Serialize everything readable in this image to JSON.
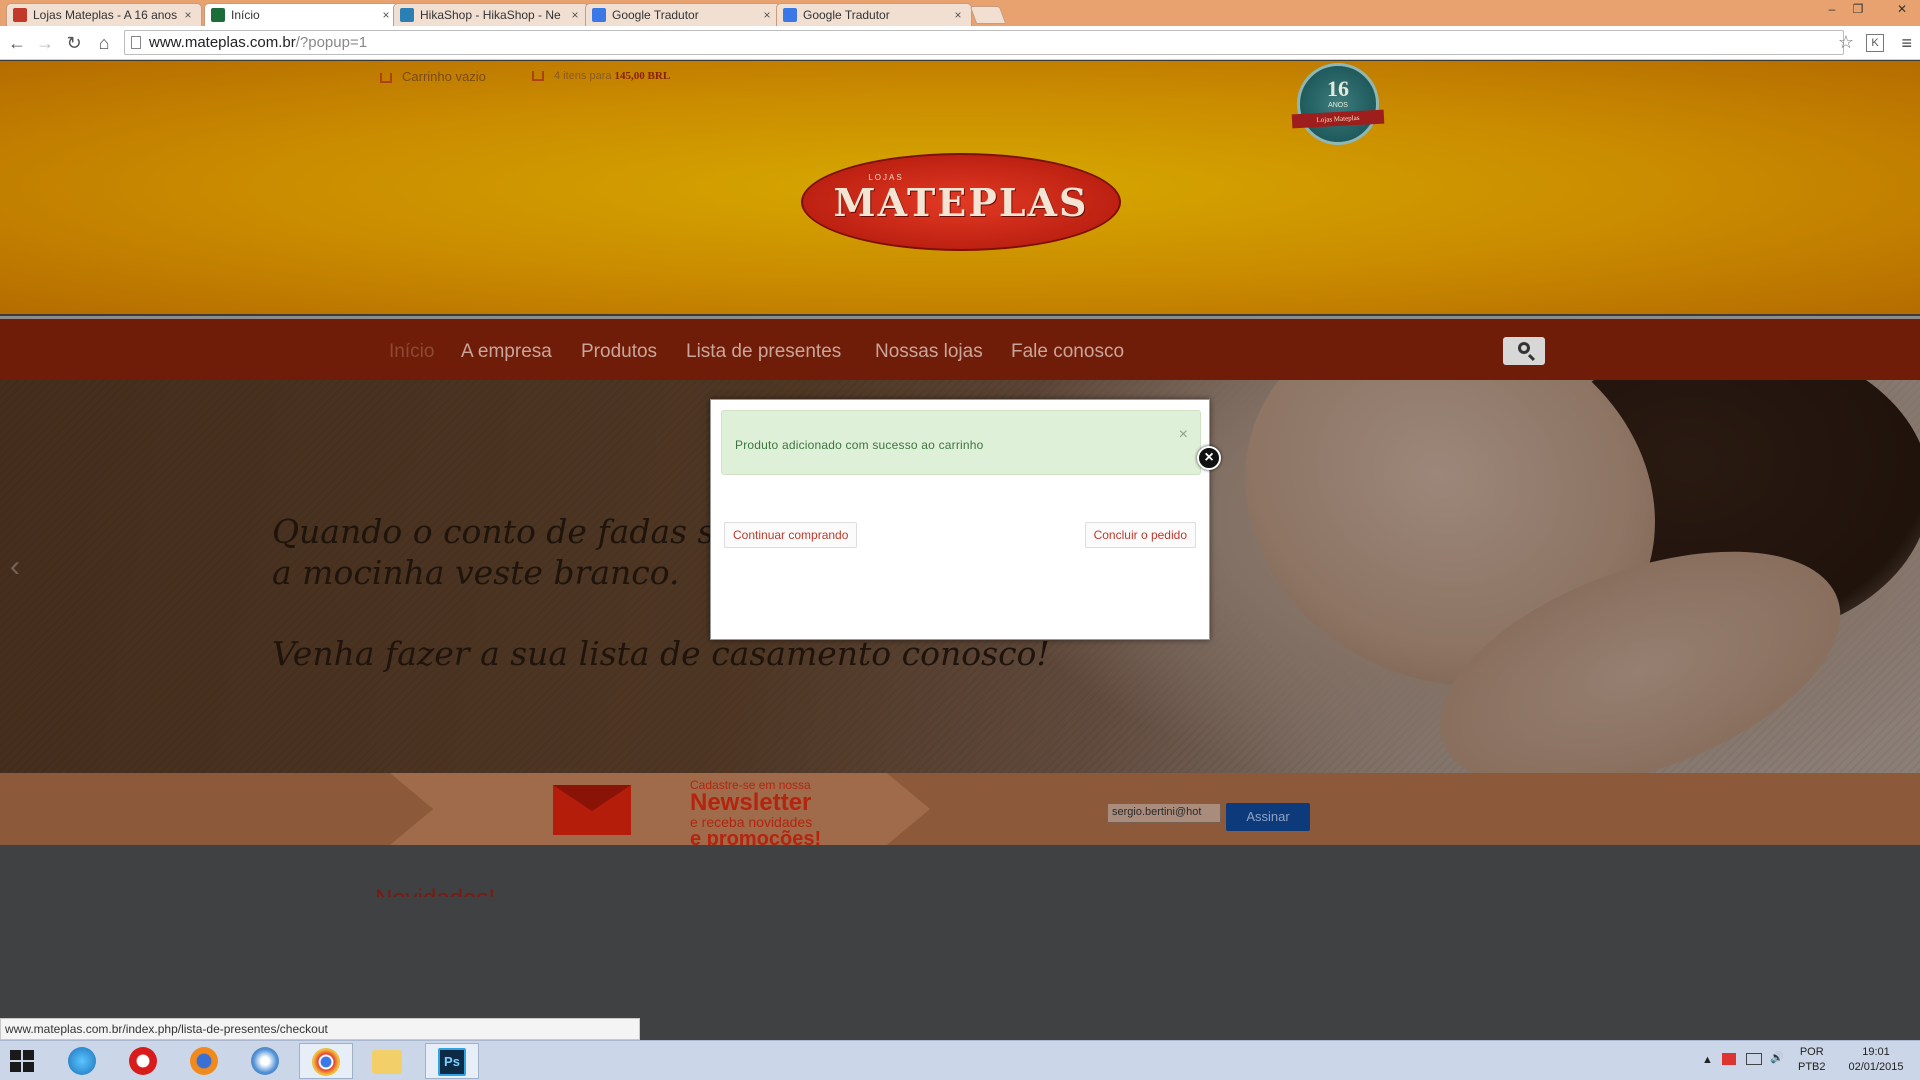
{
  "browser": {
    "tabs": [
      {
        "label": "Lojas Mateplas - A 16 anos",
        "close": "×",
        "active": false,
        "fav_color": "#c0392b"
      },
      {
        "label": "Início",
        "close": "×",
        "active": true,
        "fav_color": "#1b6e3a"
      },
      {
        "label": "HikaShop - HikaShop - Ne",
        "close": "×",
        "active": false,
        "fav_color": "#2a7fb5"
      },
      {
        "label": "Google Tradutor",
        "close": "×",
        "active": false,
        "fav_color": "#3b78e7"
      },
      {
        "label": "Google Tradutor",
        "close": "×",
        "active": false,
        "fav_color": "#3b78e7"
      }
    ],
    "window_controls": {
      "minimize": "–",
      "restore": "❐",
      "close": "✕"
    },
    "url_host": "www.mateplas.com.br",
    "url_path": "/?popup=1",
    "nav": {
      "back": "←",
      "forward": "→",
      "reload": "↻",
      "home": "⌂"
    },
    "bookmark_star": "☆",
    "extension_label": "K",
    "menu": "≡",
    "status_url": "www.mateplas.com.br/index.php/lista-de-presentes/checkout"
  },
  "site": {
    "cart_empty": "Carrinho vazio",
    "cart_summary_prefix": "4 itens para",
    "cart_summary_price": "145,00 BRL",
    "seal": {
      "number": "16",
      "sub": "ANOS",
      "ribbon": "Lojas Mateplas"
    },
    "logo": {
      "small": "LOJAS",
      "big": "MATEPLAS"
    },
    "nav_items": [
      "Início",
      "A empresa",
      "Produtos",
      "Lista de presentes",
      "Nossas lojas",
      "Fale conosco"
    ],
    "hero": {
      "line1": "Quando o conto de fadas se to",
      "line2": "a mocinha veste branco.",
      "line3": "Venha fazer a sua lista de casamento conosco!"
    },
    "newsletter": {
      "line1": "Cadastre-se em nossa",
      "line2": "Newsletter",
      "line3": "e receba novidades",
      "line4": "e promoções!",
      "email_value": "sergio.bertini@hot",
      "submit": "Assinar"
    },
    "below_heading": "Novidades!"
  },
  "modal": {
    "message": "Produto adicionado com sucesso ao carrinho",
    "dismiss": "×",
    "continue_label": "Continuar comprando",
    "checkout_label": "Concluir o pedido",
    "close_icon": "×"
  },
  "taskbar": {
    "apps": [
      "start-button",
      "internet-explorer-icon",
      "opera-icon",
      "firefox-icon",
      "safari-icon",
      "chrome-icon",
      "file-explorer-icon",
      "photoshop-icon"
    ],
    "photoshop_label": "Ps",
    "tray": {
      "lang_top": "POR",
      "lang_bottom": "PTB2",
      "time": "19:01",
      "date": "02/01/2015",
      "expand": "▲",
      "volume": "🔊"
    }
  },
  "colors": {
    "accent_red": "#c0392b",
    "alert_green": "#dff0d8",
    "nav_bg": "#6f1d08",
    "submit_blue": "#0d3a7a"
  }
}
